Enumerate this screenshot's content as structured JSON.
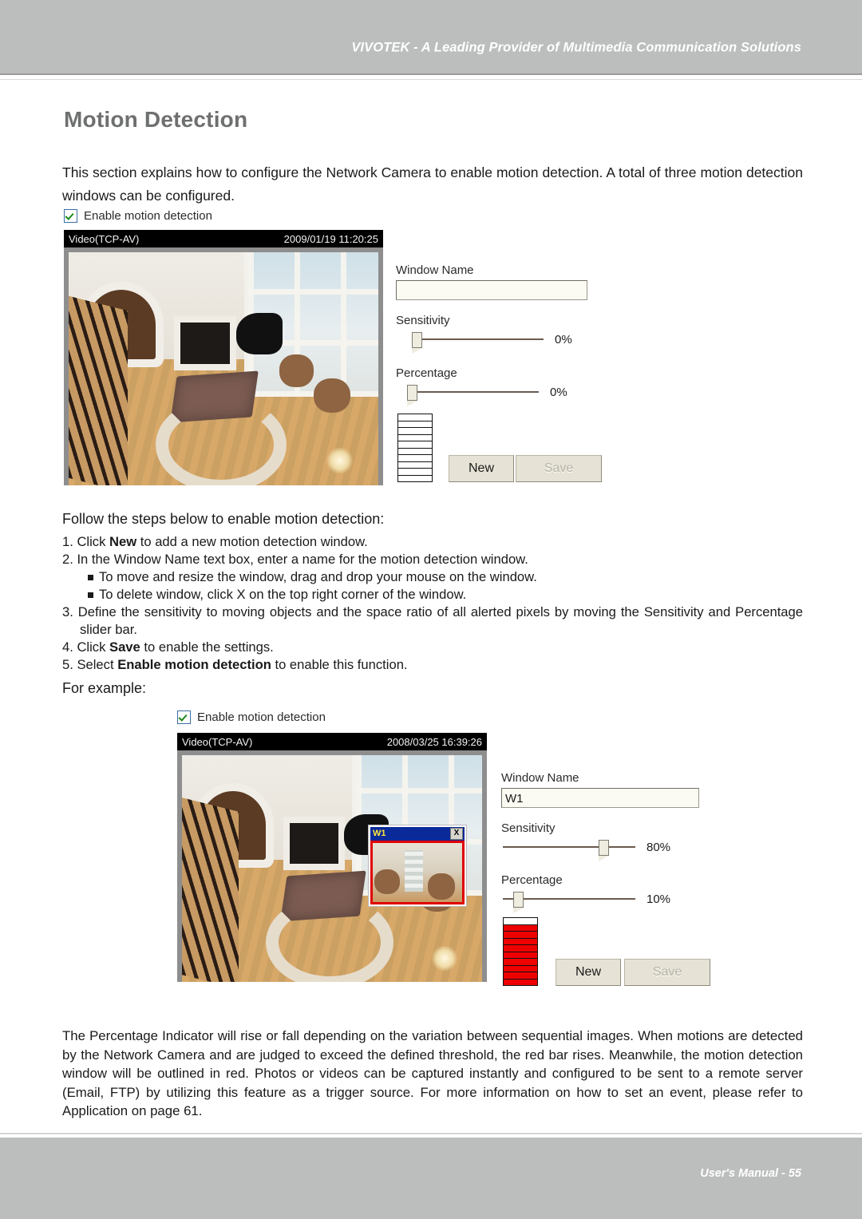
{
  "header": {
    "title": "VIVOTEK - A Leading Provider of Multimedia Communication Solutions"
  },
  "page": {
    "title": "Motion Detection"
  },
  "intro": "This section explains how to configure the Network Camera to enable motion detection. A total of three motion detection windows can be configured.",
  "follow_label": "Follow the steps below to enable motion detection:",
  "steps": {
    "s1_pre": "1. Click ",
    "s1_bold": "New",
    "s1_post": " to add a new motion detection window.",
    "s2": "2. In the Window Name text box, enter a name for the motion detection window.",
    "s2a": "To move and resize the window, drag and drop your mouse on the window.",
    "s2b": "To delete window, click X on the top right corner of the window.",
    "s3": "3. Define the sensitivity to moving objects and the space ratio of all alerted pixels by moving the Sensitivity and Percentage slider bar.",
    "s4_pre": "4. Click ",
    "s4_bold": "Save",
    "s4_post": " to enable the settings.",
    "s5_pre": "5. Select ",
    "s5_bold": "Enable motion detection",
    "s5_post": " to enable this function."
  },
  "for_example_label": "For example:",
  "panel1": {
    "checkbox_label": "Enable motion detection",
    "checkbox_checked": true,
    "video_source": "Video(TCP-AV)",
    "video_timestamp": "2009/01/19 11:20:25",
    "window_name_label": "Window Name",
    "window_name_value": "",
    "sensitivity_label": "Sensitivity",
    "sensitivity_value": "0%",
    "sensitivity_pct": 0,
    "percentage_label": "Percentage",
    "percentage_value": "0%",
    "percentage_pct": 0,
    "indicator_segments": 10,
    "indicator_filled": 0,
    "new_button": "New",
    "save_button": "Save",
    "save_disabled": true
  },
  "panel2": {
    "checkbox_label": "Enable motion detection",
    "checkbox_checked": true,
    "video_source": "Video(TCP-AV)",
    "video_timestamp": "2008/03/25 16:39:26",
    "motion_window_title": "W1",
    "motion_window_close": "X",
    "window_name_label": "Window Name",
    "window_name_value": "W1",
    "sensitivity_label": "Sensitivity",
    "sensitivity_value": "80%",
    "sensitivity_pct": 80,
    "percentage_label": "Percentage",
    "percentage_value": "10%",
    "percentage_pct": 10,
    "indicator_segments": 10,
    "indicator_filled": 9,
    "new_button": "New",
    "save_button": "Save",
    "save_disabled": true
  },
  "closing": "The Percentage Indicator will rise or fall depending on the variation between sequential images. When motions are detected by the Network Camera and are judged to exceed the defined threshold, the red bar rises. Meanwhile, the motion detection window will be outlined in red. Photos or videos can be captured instantly and configured to be sent to a remote server (Email, FTP) by utilizing this feature as a trigger source. For more information on how to set an event, please refer to Application on page 61.",
  "footer": {
    "text": "User's Manual - 55"
  },
  "colors": {
    "band": "#bcbdbd",
    "title": "#6e6f70",
    "accent_red": "#ee0000",
    "window_titlebar": "#0a2a9a",
    "window_title_text": "#ffe63a"
  }
}
